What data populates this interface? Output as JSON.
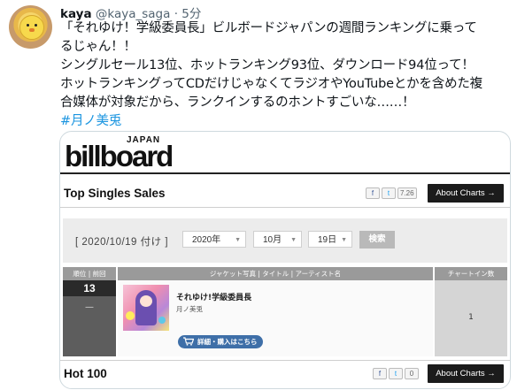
{
  "tweet": {
    "display_name": "kaya",
    "handle": "@kaya_saga",
    "separator": "·",
    "time": "5分",
    "lines": [
      "「それゆけ！学級委員長」ビルボードジャパンの週間ランキングに乗って",
      "るじゃん！！",
      "シングルセール13位、ホットランキング93位、ダウンロード94位って！",
      "ホットランキングってCDだけじゃなくてラジオやYouTubeとかを含めた複",
      "合媒体が対象だから、ランクインするのホントすごいな……！"
    ],
    "hashtag": "#月ノ美兎"
  },
  "card": {
    "logo_japan": "JAPAN",
    "logo_word": "billboard",
    "section1": {
      "title": "Top Singles Sales",
      "social": [
        "f",
        "t",
        "7.26"
      ],
      "about": "About Charts"
    },
    "filter": {
      "date_label": "[ 2020/10/19 付け ]",
      "year": "2020年",
      "month": "10月",
      "day": "19日",
      "search": "検索"
    },
    "table": {
      "col_rank": "順位 | 前回",
      "col_main": "ジャケット写真 | タイトル | アーティスト名",
      "col_chartin": "チャートイン数",
      "rank": "13",
      "prev_rank": "—",
      "song": "それゆけ!学級委員長",
      "artist": "月ノ美兎",
      "buy": "詳細・購入はこちら",
      "chart_in": "1"
    },
    "section2": {
      "title": "Hot 100",
      "social": [
        "f",
        "t",
        "0"
      ],
      "about": "About Charts"
    }
  }
}
